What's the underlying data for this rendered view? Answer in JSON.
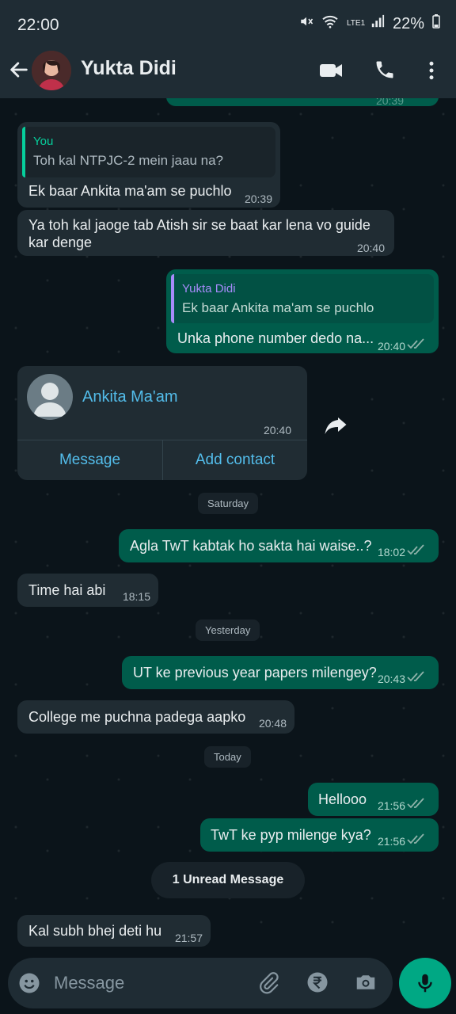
{
  "status": {
    "time": "22:00",
    "battery": "22%",
    "network": "LTE1"
  },
  "header": {
    "name": "Yukta Didi",
    "icons": [
      "back-arrow-icon",
      "video-call-icon",
      "phone-icon",
      "menu-dots-icon"
    ]
  },
  "messages": {
    "m_partial_time": "20:39",
    "m1": {
      "reply_name": "You",
      "reply_text": "Toh kal NTPJC-2 mein jaau na?",
      "text": "Ek baar Ankita ma'am se puchlo",
      "time": "20:39"
    },
    "m2": {
      "text1": "Ya toh kal jaoge tab Atish sir se baat kar lena vo guide",
      "text2": "kar denge",
      "time": "20:40"
    },
    "m3": {
      "reply_name": "Yukta Didi",
      "reply_text": "Ek baar Ankita ma'am se puchlo",
      "text": "Unka phone number dedo na...",
      "time": "20:40"
    },
    "m4": {
      "contact_name": "Ankita Ma'am",
      "time": "20:40",
      "action1": "Message",
      "action2": "Add contact"
    },
    "day1": "Saturday",
    "m5": {
      "text": "Agla TwT kabtak ho sakta hai waise..?",
      "time": "18:02"
    },
    "m6": {
      "text": "Time hai abi",
      "time": "18:15"
    },
    "day2": "Yesterday",
    "m7": {
      "text": "UT ke previous year papers milengey?",
      "time": "20:43"
    },
    "m8": {
      "text": "College me puchna padega aapko",
      "time": "20:48"
    },
    "day3": "Today",
    "m9": {
      "text": "Hellooo",
      "time": "21:56"
    },
    "m10": {
      "text": "TwT ke pyp milenge kya?",
      "time": "21:56"
    },
    "unread": "1 Unread Message",
    "m11": {
      "text": "Kal subh bhej deti hu",
      "time": "21:57"
    }
  },
  "composer": {
    "placeholder": "Message",
    "icons": [
      "emoji-icon",
      "attach-icon",
      "rupee-icon",
      "camera-icon",
      "mic-icon"
    ]
  },
  "colors": {
    "accent": "#00a884",
    "outgoing": "#005c4b",
    "incoming": "#202c33",
    "link": "#53bdeb",
    "reply_you": "#06cf9c",
    "reply_other": "#a78bfa"
  }
}
